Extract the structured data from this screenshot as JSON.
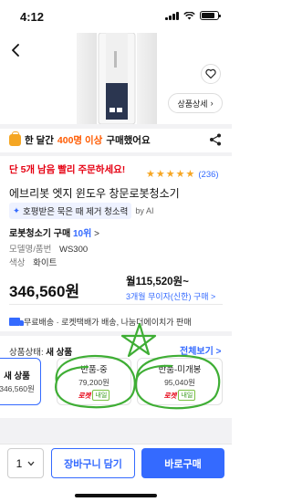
{
  "status_bar": {
    "time": "4:12"
  },
  "hero": {
    "detail_label": "상품상세"
  },
  "banner": {
    "prefix": "한 달간",
    "count": "400명 이상",
    "suffix": "구매했어요"
  },
  "urgent": "단 5개 남음 빨리 주문하세요!",
  "rating": {
    "stars": 5,
    "count": "(236)"
  },
  "product": {
    "title": "에브리봇 엣지 윈도우 창문로봇청소기",
    "ai_chip": "호평받은 묵은 때 제거 청소력",
    "ai_by_prefix": "by",
    "ai_by": "AI",
    "rank_label": "로봇청소기 구매",
    "rank_num": "10위",
    "rank_chev": ">",
    "spec_model_key": "모델명/품번",
    "spec_model_val": "WS300",
    "spec_color_key": "색상",
    "spec_color_val": "화이트"
  },
  "pricing": {
    "price": "346,560원",
    "monthly": "월115,520원~",
    "installment": "3개월 무이자(신한) 구매 >"
  },
  "shipping": "무료배송 · 로켓택배가 배송, 나눔더에이치가 판매",
  "condition": {
    "label": "상품상태:",
    "value": "새 상품",
    "see_all": "전체보기 >"
  },
  "cards": [
    {
      "title": "새 상품",
      "price": "346,560원",
      "selected": true
    },
    {
      "title": "반품-중",
      "price": "79,200원",
      "rocket": "로켓",
      "tag": "내일"
    },
    {
      "title": "반품-미개봉",
      "price": "95,040원",
      "rocket": "로켓",
      "tag": "내일"
    }
  ],
  "bottom_bar": {
    "qty": "1",
    "cart_label": "장바구니 담기",
    "buy_label": "바로구매"
  },
  "colors": {
    "accent": "#346aff",
    "urgent": "#e60012",
    "highlight": "#ff5a00",
    "annotation": "#3fae35"
  }
}
